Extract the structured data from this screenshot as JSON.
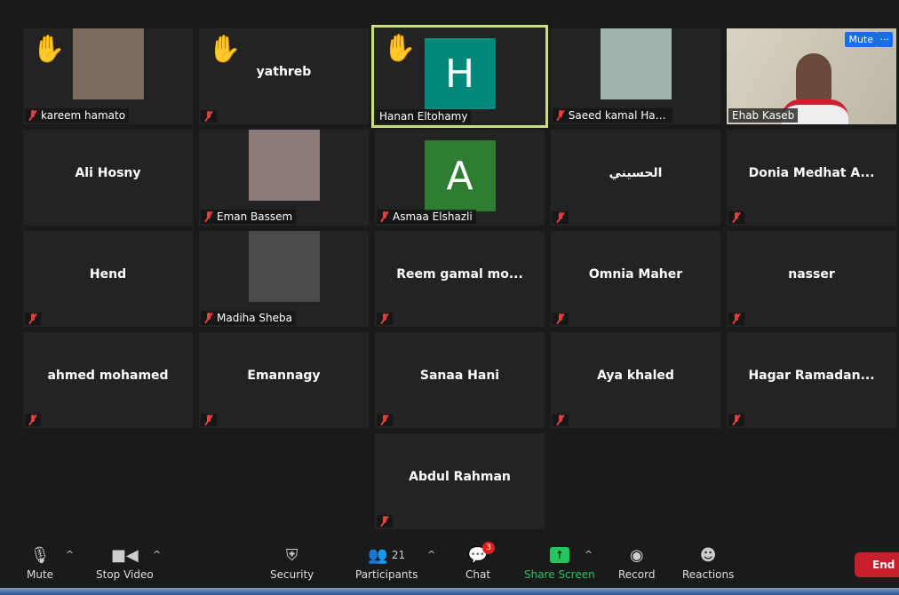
{
  "participants": [
    {
      "name": "kareem hamato",
      "hand": true,
      "muted": true,
      "kind": "photo",
      "photo_color": "#7a6a60"
    },
    {
      "name": "yathreb",
      "hand": true,
      "muted": true,
      "kind": "name"
    },
    {
      "name": "Hanan Eltohamy",
      "hand": true,
      "muted": false,
      "kind": "avatar",
      "initial": "H",
      "avatar_color": "#00897b",
      "active": true
    },
    {
      "name": "Saeed kamal Has...",
      "hand": false,
      "muted": true,
      "kind": "photo",
      "photo_color": "#9fb4ae"
    },
    {
      "name": "Ehab Kaseb",
      "hand": false,
      "muted": false,
      "kind": "video"
    },
    {
      "name": "Ali Hosny",
      "muted": false,
      "kind": "name"
    },
    {
      "name": "Eman Bassem",
      "muted": true,
      "kind": "photo",
      "photo_color": "#8a7a78"
    },
    {
      "name": "Asmaa Elshazli",
      "muted": true,
      "kind": "avatar",
      "initial": "A",
      "avatar_color": "#2e7d32"
    },
    {
      "name": "الحسيني",
      "muted": true,
      "kind": "name"
    },
    {
      "name": "Donia Medhat A...",
      "muted": true,
      "kind": "name"
    },
    {
      "name": "Hend",
      "muted": true,
      "kind": "name"
    },
    {
      "name": "Madiha Sheba",
      "muted": true,
      "kind": "photo",
      "photo_color": "#4a4a4a"
    },
    {
      "name": "Reem gamal mo...",
      "muted": true,
      "kind": "name"
    },
    {
      "name": "Omnia Maher",
      "muted": true,
      "kind": "name"
    },
    {
      "name": "nasser",
      "muted": true,
      "kind": "name"
    },
    {
      "name": "ahmed mohamed",
      "muted": true,
      "kind": "name"
    },
    {
      "name": "Emannagy",
      "muted": true,
      "kind": "name"
    },
    {
      "name": "Sanaa Hani",
      "muted": true,
      "kind": "name"
    },
    {
      "name": "Aya khaled",
      "muted": true,
      "kind": "name"
    },
    {
      "name": "Hagar  Ramadan...",
      "muted": true,
      "kind": "name"
    },
    {
      "name": "Abdul Rahman",
      "muted": true,
      "kind": "name"
    }
  ],
  "video_controls": {
    "mute": "Mute",
    "more": "···"
  },
  "toolbar": {
    "mute": "Mute",
    "stop_video": "Stop Video",
    "security": "Security",
    "participants": "Participants",
    "participants_count": "21",
    "chat": "Chat",
    "chat_badge": "3",
    "share_screen": "Share Screen",
    "record": "Record",
    "reactions": "Reactions",
    "end": "End"
  },
  "colors": {
    "active_border": "#c9e07a",
    "share_green": "#22c55e",
    "end_red": "#c8202a"
  }
}
